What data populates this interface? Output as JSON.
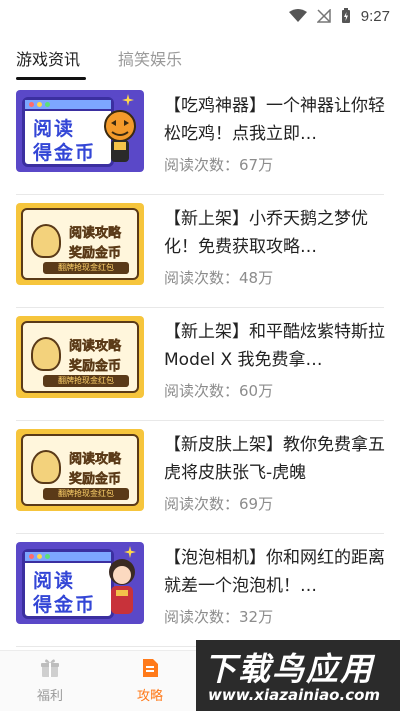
{
  "status_bar": {
    "time": "9:27"
  },
  "tabs": [
    {
      "label": "游戏资讯",
      "active": true
    },
    {
      "label": "搞笑娱乐",
      "active": false
    }
  ],
  "articles": [
    {
      "title": "【吃鸡神器】一个神器让你轻松吃鸡！点我立即…",
      "reads": "阅读次数：67万",
      "thumb": {
        "style": "blue",
        "line1": "阅读",
        "line2": "得金币"
      }
    },
    {
      "title": "【新上架】小乔天鹅之梦优化！免费获取攻略…",
      "reads": "阅读次数：48万",
      "thumb": {
        "style": "yellow",
        "line1": "阅读攻略",
        "line2": "奖励金币",
        "band": "翻牌抢现金红包"
      }
    },
    {
      "title": "【新上架】和平酷炫紫特斯拉Model X 我免费拿…",
      "reads": "阅读次数：60万",
      "thumb": {
        "style": "yellow",
        "line1": "阅读攻略",
        "line2": "奖励金币",
        "band": "翻牌抢现金红包"
      }
    },
    {
      "title": "【新皮肤上架】教你免费拿五虎将皮肤张飞-虎魄",
      "reads": "阅读次数：69万",
      "thumb": {
        "style": "yellow",
        "line1": "阅读攻略",
        "line2": "奖励金币",
        "band": "翻牌抢现金红包"
      }
    },
    {
      "title": "【泡泡相机】你和网红的距离就差一个泡泡机！…",
      "reads": "阅读次数：32万",
      "thumb": {
        "style": "blue",
        "line1": "阅读",
        "line2": "得金币"
      }
    }
  ],
  "bottom_nav": [
    {
      "label": "福利",
      "icon": "gift-icon",
      "active": false
    },
    {
      "label": "攻略",
      "icon": "document-icon",
      "active": true
    }
  ],
  "watermark": {
    "text": "下载鸟应用",
    "url": "www.xiazainiao.com"
  },
  "colors": {
    "accent": "#ff7a1a",
    "inactive": "#9a9a9a",
    "title": "#222222",
    "meta": "#8c8c8c"
  }
}
